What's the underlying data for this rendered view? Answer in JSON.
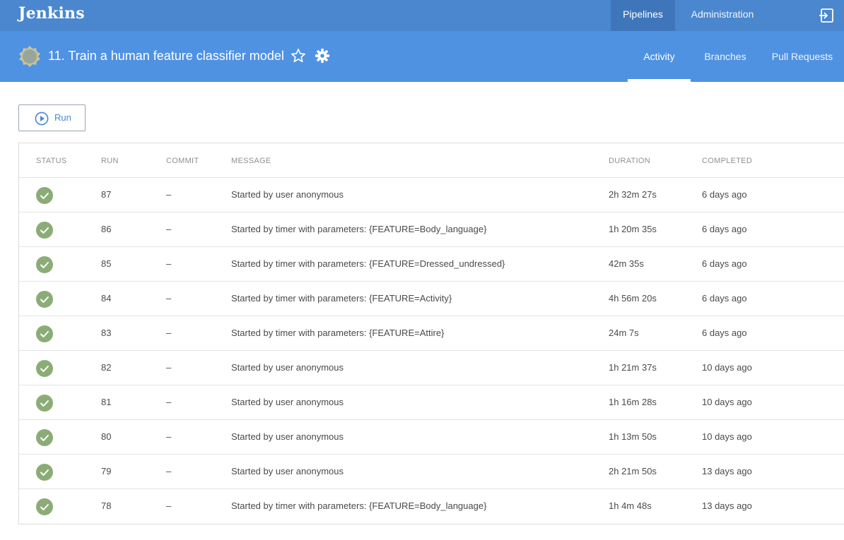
{
  "app": {
    "brand": "Jenkins"
  },
  "topnav": {
    "pipelines": "Pipelines",
    "administration": "Administration",
    "logout_icon": "logout-icon"
  },
  "pipeline": {
    "title": "11. Train a human feature classifier model",
    "weather_icon": "weather-cloudy-icon"
  },
  "tabs": [
    {
      "label": "Activity",
      "active": true
    },
    {
      "label": "Branches",
      "active": false
    },
    {
      "label": "Pull Requests",
      "active": false
    }
  ],
  "run_button": {
    "label": "Run"
  },
  "table": {
    "columns": [
      "STATUS",
      "RUN",
      "COMMIT",
      "MESSAGE",
      "DURATION",
      "COMPLETED"
    ],
    "rows": [
      {
        "status": "success",
        "run": "87",
        "commit": "–",
        "message": "Started by user anonymous",
        "duration": "2h 32m 27s",
        "completed": "6 days ago"
      },
      {
        "status": "success",
        "run": "86",
        "commit": "–",
        "message": "Started by timer with parameters: {FEATURE=Body_language}",
        "duration": "1h 20m 35s",
        "completed": "6 days ago"
      },
      {
        "status": "success",
        "run": "85",
        "commit": "–",
        "message": "Started by timer with parameters: {FEATURE=Dressed_undressed}",
        "duration": "42m 35s",
        "completed": "6 days ago"
      },
      {
        "status": "success",
        "run": "84",
        "commit": "–",
        "message": "Started by timer with parameters: {FEATURE=Activity}",
        "duration": "4h 56m 20s",
        "completed": "6 days ago"
      },
      {
        "status": "success",
        "run": "83",
        "commit": "–",
        "message": "Started by timer with parameters: {FEATURE=Attire}",
        "duration": "24m 7s",
        "completed": "6 days ago"
      },
      {
        "status": "success",
        "run": "82",
        "commit": "–",
        "message": "Started by user anonymous",
        "duration": "1h 21m 37s",
        "completed": "10 days ago"
      },
      {
        "status": "success",
        "run": "81",
        "commit": "–",
        "message": "Started by user anonymous",
        "duration": "1h 16m 28s",
        "completed": "10 days ago"
      },
      {
        "status": "success",
        "run": "80",
        "commit": "–",
        "message": "Started by user anonymous",
        "duration": "1h 13m 50s",
        "completed": "10 days ago"
      },
      {
        "status": "success",
        "run": "79",
        "commit": "–",
        "message": "Started by user anonymous",
        "duration": "2h 21m 50s",
        "completed": "13 days ago"
      },
      {
        "status": "success",
        "run": "78",
        "commit": "–",
        "message": "Started by timer with parameters: {FEATURE=Body_language}",
        "duration": "1h 4m 48s",
        "completed": "13 days ago"
      }
    ]
  },
  "colors": {
    "topbar": "#4a87cf",
    "subheader": "#4f92e2",
    "success": "#8cac77",
    "link": "#4a87cf"
  }
}
